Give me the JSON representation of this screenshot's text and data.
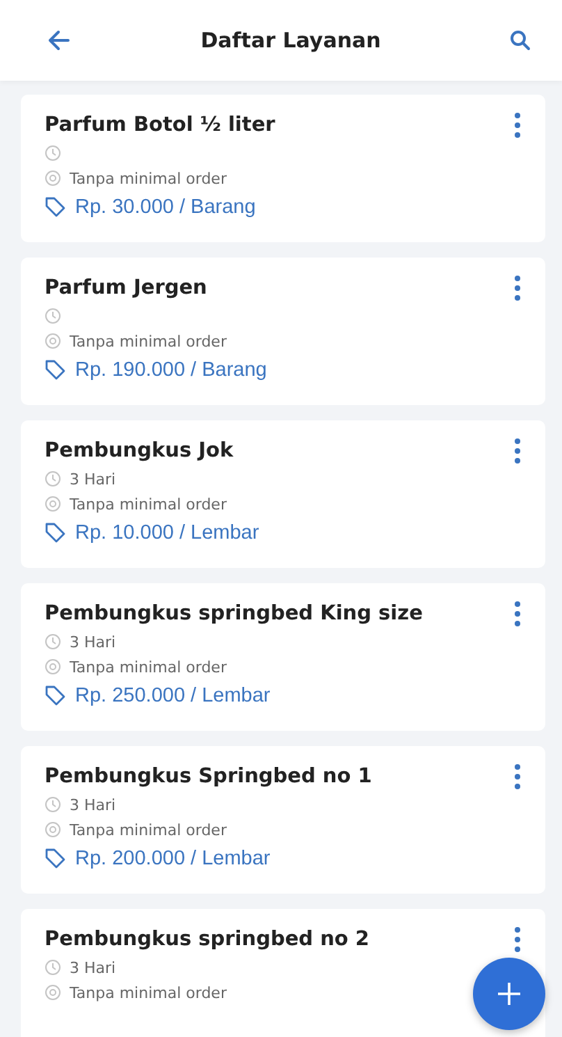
{
  "header": {
    "title": "Daftar Layanan"
  },
  "services": [
    {
      "name": "Parfum Botol ½ liter",
      "min_order": "Tanpa minimal order",
      "price": "Rp. 30.000 / Barang"
    },
    {
      "name": "Parfum Jergen",
      "min_order": "Tanpa minimal order",
      "price": "Rp. 190.000 / Barang"
    },
    {
      "name": "Pembungkus Jok",
      "duration": "3 Hari",
      "min_order": "Tanpa minimal order",
      "price": "Rp. 10.000 / Lembar"
    },
    {
      "name": "Pembungkus springbed King size",
      "duration": "3 Hari",
      "min_order": "Tanpa minimal order",
      "price": "Rp. 250.000 / Lembar"
    },
    {
      "name": "Pembungkus Springbed no 1",
      "duration": "3 Hari",
      "min_order": "Tanpa minimal order",
      "price": "Rp. 200.000 / Lembar"
    },
    {
      "name": "Pembungkus springbed no 2",
      "duration": "3 Hari",
      "min_order": "Tanpa minimal order"
    }
  ]
}
